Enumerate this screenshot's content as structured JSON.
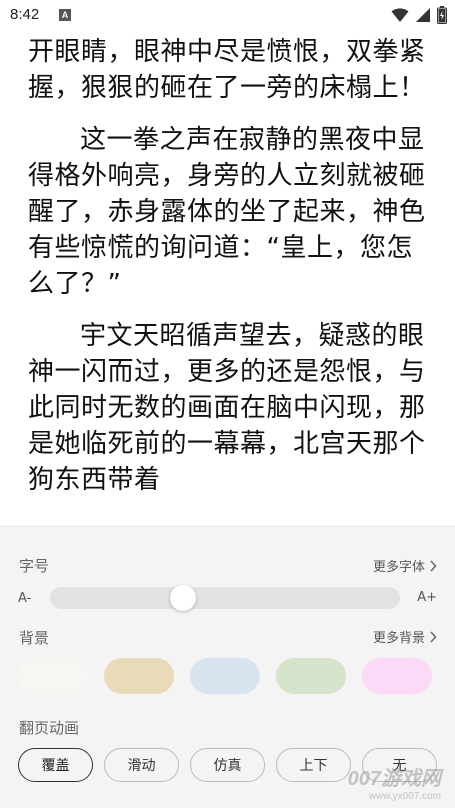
{
  "status_bar": {
    "time": "8:42",
    "notification_badge": "A",
    "icons": [
      "wifi-icon",
      "signal-icon",
      "battery-icon"
    ]
  },
  "reader": {
    "paragraphs": [
      "开眼睛，眼神中尽是愤恨，双拳紧握，狠狠的砸在了一旁的床榻上！",
      "这一拳之声在寂静的黑夜中显得格外响亮，身旁的人立刻就被砸醒了，赤身露体的坐了起来，神色有些惊慌的询问道：“皇上，您怎么了？”",
      "宇文天昭循声望去，疑惑的眼神一闪而过，更多的还是怨恨，与此同时无数的画面在脑中闪现，那是她临死前的一幕幕，北宫天那个狗东西带着"
    ]
  },
  "settings": {
    "font_size": {
      "label": "字号",
      "more": "更多字体",
      "small": "A-",
      "large": "A+",
      "level": 0.38
    },
    "background": {
      "label": "背景",
      "more": "更多背景",
      "swatches": [
        "#f6f6f3",
        "#eadbb8",
        "#d7e4ef",
        "#d5e4cb",
        "#fbd9f7"
      ]
    },
    "page_animation": {
      "label": "翻页动画",
      "options": [
        "覆盖",
        "滑动",
        "仿真",
        "上下",
        "无"
      ],
      "selected": "覆盖"
    }
  },
  "watermark": {
    "brand": "007游戏网",
    "url": "www.yx007.com"
  }
}
